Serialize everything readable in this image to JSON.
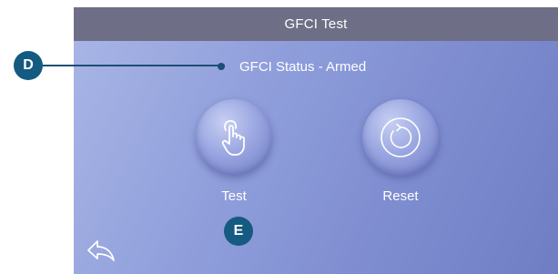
{
  "header": {
    "title": "GFCI Test"
  },
  "status": {
    "text": "GFCI Status - Armed"
  },
  "buttons": {
    "test_label": "Test",
    "reset_label": "Reset"
  },
  "icons": {
    "test": "hand-pointer-icon",
    "reset": "refresh-circle-icon",
    "back": "back-arrow-icon"
  },
  "callouts": {
    "d": "D",
    "e": "E"
  },
  "colors": {
    "title_bar": "#6e6f86",
    "callout": "#155a80",
    "screen_light": "#a9b6e6",
    "screen_dark": "#6f7dc3"
  }
}
